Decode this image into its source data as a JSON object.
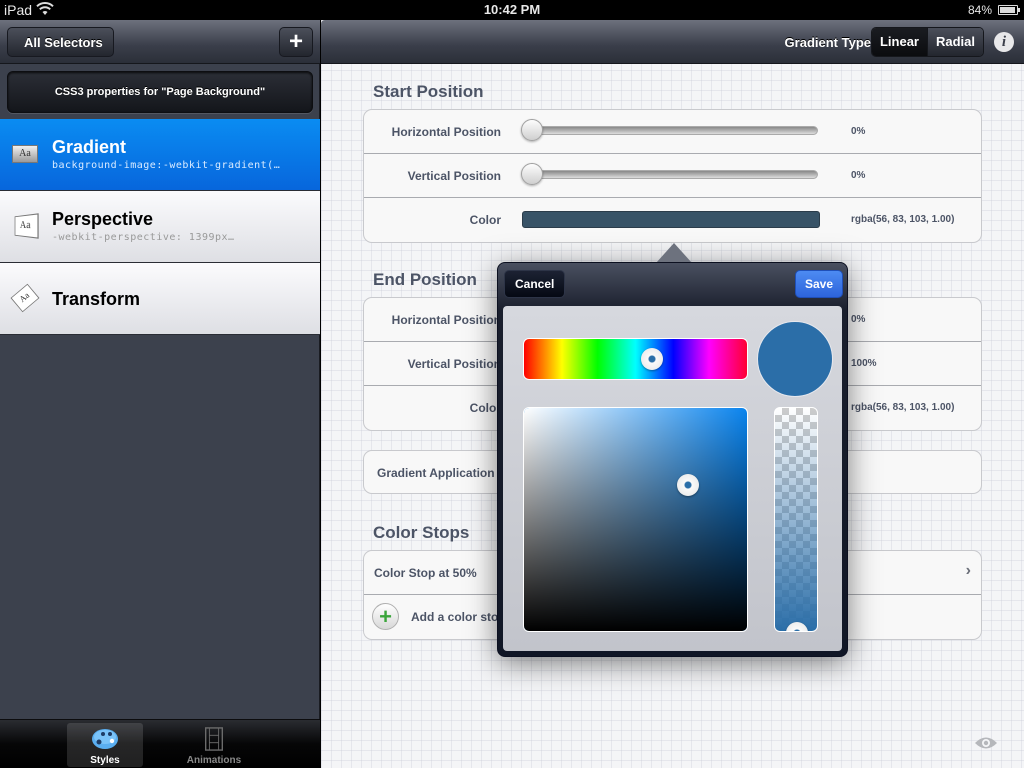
{
  "status_bar": {
    "carrier": "iPad",
    "time": "10:42 PM",
    "battery": "84%",
    "battery_level": 0.84
  },
  "left_panel": {
    "back_button": "All Selectors",
    "add_button": "+",
    "header": "CSS3 properties for \"Page Background\"",
    "properties": [
      {
        "icon": "gradient-icon",
        "title": "Gradient",
        "subtitle": "background-image:-webkit-gradient(…",
        "selected": true
      },
      {
        "icon": "perspective-icon",
        "title": "Perspective",
        "subtitle": "-webkit-perspective: 1399px…",
        "selected": false
      },
      {
        "icon": "transform-icon",
        "title": "Transform",
        "subtitle": "",
        "selected": false
      }
    ],
    "tabs": [
      {
        "label": "Styles",
        "icon": "palette-icon",
        "active": true
      },
      {
        "label": "Animations",
        "icon": "film-icon",
        "active": false
      }
    ]
  },
  "toolbar": {
    "gradient_type_label": "Gradient Type",
    "segments": [
      {
        "label": "Linear",
        "active": true
      },
      {
        "label": "Radial",
        "active": false
      }
    ],
    "info": "i"
  },
  "start_position": {
    "title": "Start Position",
    "rows": [
      {
        "label": "Horizontal Position",
        "value": "0%",
        "slider": 0
      },
      {
        "label": "Vertical Position",
        "value": "0%",
        "slider": 0
      },
      {
        "label": "Color",
        "value": "rgba(56, 83, 103, 1.00)",
        "color": "#385367"
      }
    ]
  },
  "end_position": {
    "title": "End Position",
    "rows": [
      {
        "label": "Horizontal Position",
        "value": "0%",
        "slider": 0
      },
      {
        "label": "Vertical Position",
        "value": "100%",
        "slider": 1
      },
      {
        "label": "Color",
        "value": "rgba(56, 83, 103, 1.00)",
        "color": "#385367"
      }
    ]
  },
  "gradient_application": {
    "label": "Gradient Application"
  },
  "color_stops": {
    "title": "Color Stops",
    "items": [
      {
        "label": "Color Stop at 50%"
      }
    ],
    "add_label": "Add a color stop"
  },
  "color_picker": {
    "cancel": "Cancel",
    "save": "Save",
    "hue_position": 0.57,
    "hue_color": "#0a84ee",
    "preview_color": "#2b6ea8",
    "saturation": 0.73,
    "brightness": 0.66,
    "alpha": 1.0
  },
  "colors": {
    "selection_blue": "#0766dc",
    "save_blue": "#2d64dc",
    "label_gray": "#4c5466"
  }
}
